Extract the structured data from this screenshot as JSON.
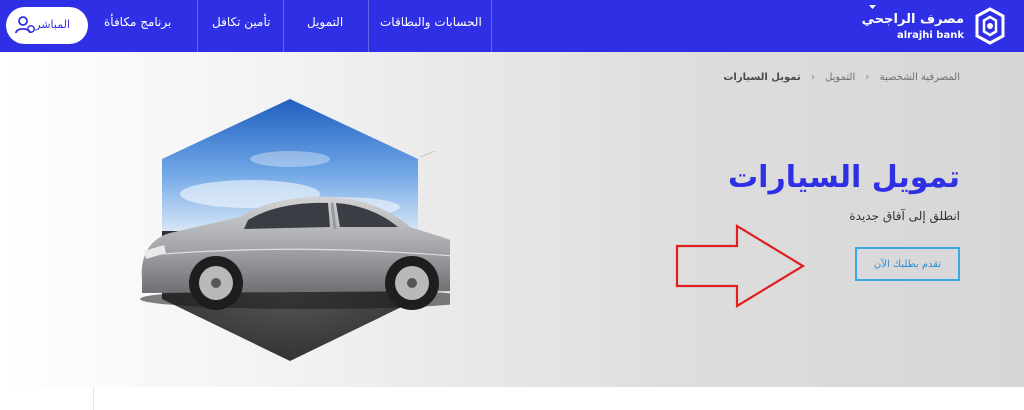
{
  "header": {
    "logo": {
      "arabic": "مصرف الراجحي",
      "english": "alrajhi bank"
    },
    "nav": [
      {
        "label": "الحسابات والبطاقات"
      },
      {
        "label": "التمويل"
      },
      {
        "label": "تأمين تكافل"
      },
      {
        "label": "برنامج مكافأة"
      }
    ],
    "live_button": {
      "label": "المباشر"
    },
    "colors": {
      "brand": "#2f2fe6",
      "live_bg": "#ffffff"
    }
  },
  "breadcrumb": {
    "items": [
      "المصرفية الشخصية",
      "التمويل",
      "تمويل السيارات"
    ],
    "separator": "‹"
  },
  "hero": {
    "title": "تمويل السيارات",
    "subtitle": "انطلق إلى آفاق جديدة",
    "cta_label": "تقدم بطلبك الآن",
    "colors": {
      "title": "#2f2fe6",
      "cta_border": "#3aa8e6",
      "annotation_arrow": "#e02020"
    },
    "image_icon": "car-in-hexagon-image",
    "annotation_icon": "red-arrow-pointing-right"
  }
}
